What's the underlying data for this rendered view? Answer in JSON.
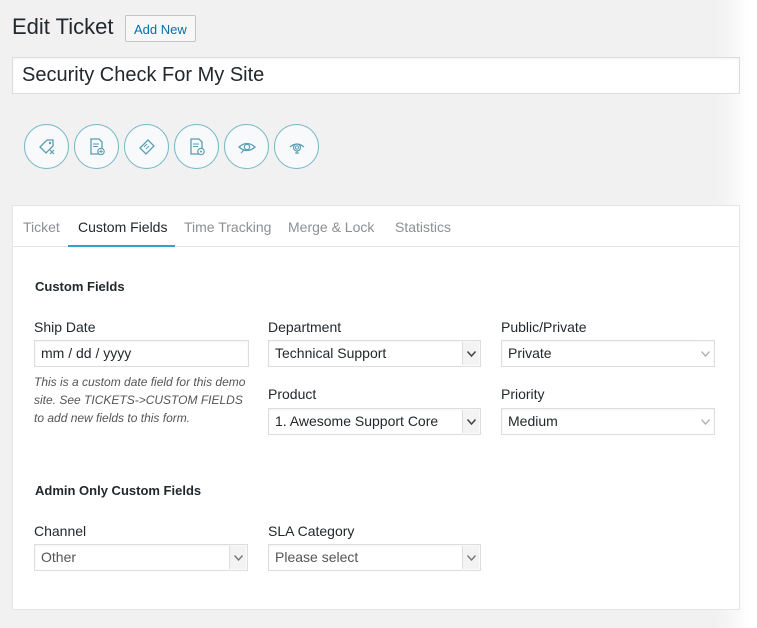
{
  "header": {
    "title": "Edit Ticket",
    "add_new_label": "Add New"
  },
  "ticket": {
    "title_value": "Security Check For My Site"
  },
  "toolbar": {
    "icons": [
      "tag-icon",
      "document-add-icon",
      "ticket-icon",
      "document-settings-icon",
      "eye-icon",
      "fingerprint-icon"
    ]
  },
  "tabs": [
    {
      "label": "Ticket"
    },
    {
      "label": "Custom Fields"
    },
    {
      "label": "Time Tracking"
    },
    {
      "label": "Merge & Lock"
    },
    {
      "label": "Statistics"
    }
  ],
  "active_tab": "Custom Fields",
  "custom_fields": {
    "section_title": "Custom Fields",
    "ship_date": {
      "label": "Ship Date",
      "placeholder": "mm / dd / yyyy",
      "help": "This is a custom date field for this demo site. See TICKETS->CUSTOM FIELDS to add new fields to this form."
    },
    "department": {
      "label": "Department",
      "value": "Technical Support"
    },
    "public_private": {
      "label": "Public/Private",
      "value": "Private"
    },
    "product": {
      "label": "Product",
      "value": "1. Awesome Support Core"
    },
    "priority": {
      "label": "Priority",
      "value": "Medium"
    }
  },
  "admin_fields": {
    "section_title": "Admin Only Custom Fields",
    "channel": {
      "label": "Channel",
      "value": "Other"
    },
    "sla_category": {
      "label": "SLA Category",
      "value": "Please select"
    }
  },
  "colors": {
    "accent": "#2ea2cc",
    "link": "#0073aa",
    "icon_border": "#7bb8c8"
  }
}
